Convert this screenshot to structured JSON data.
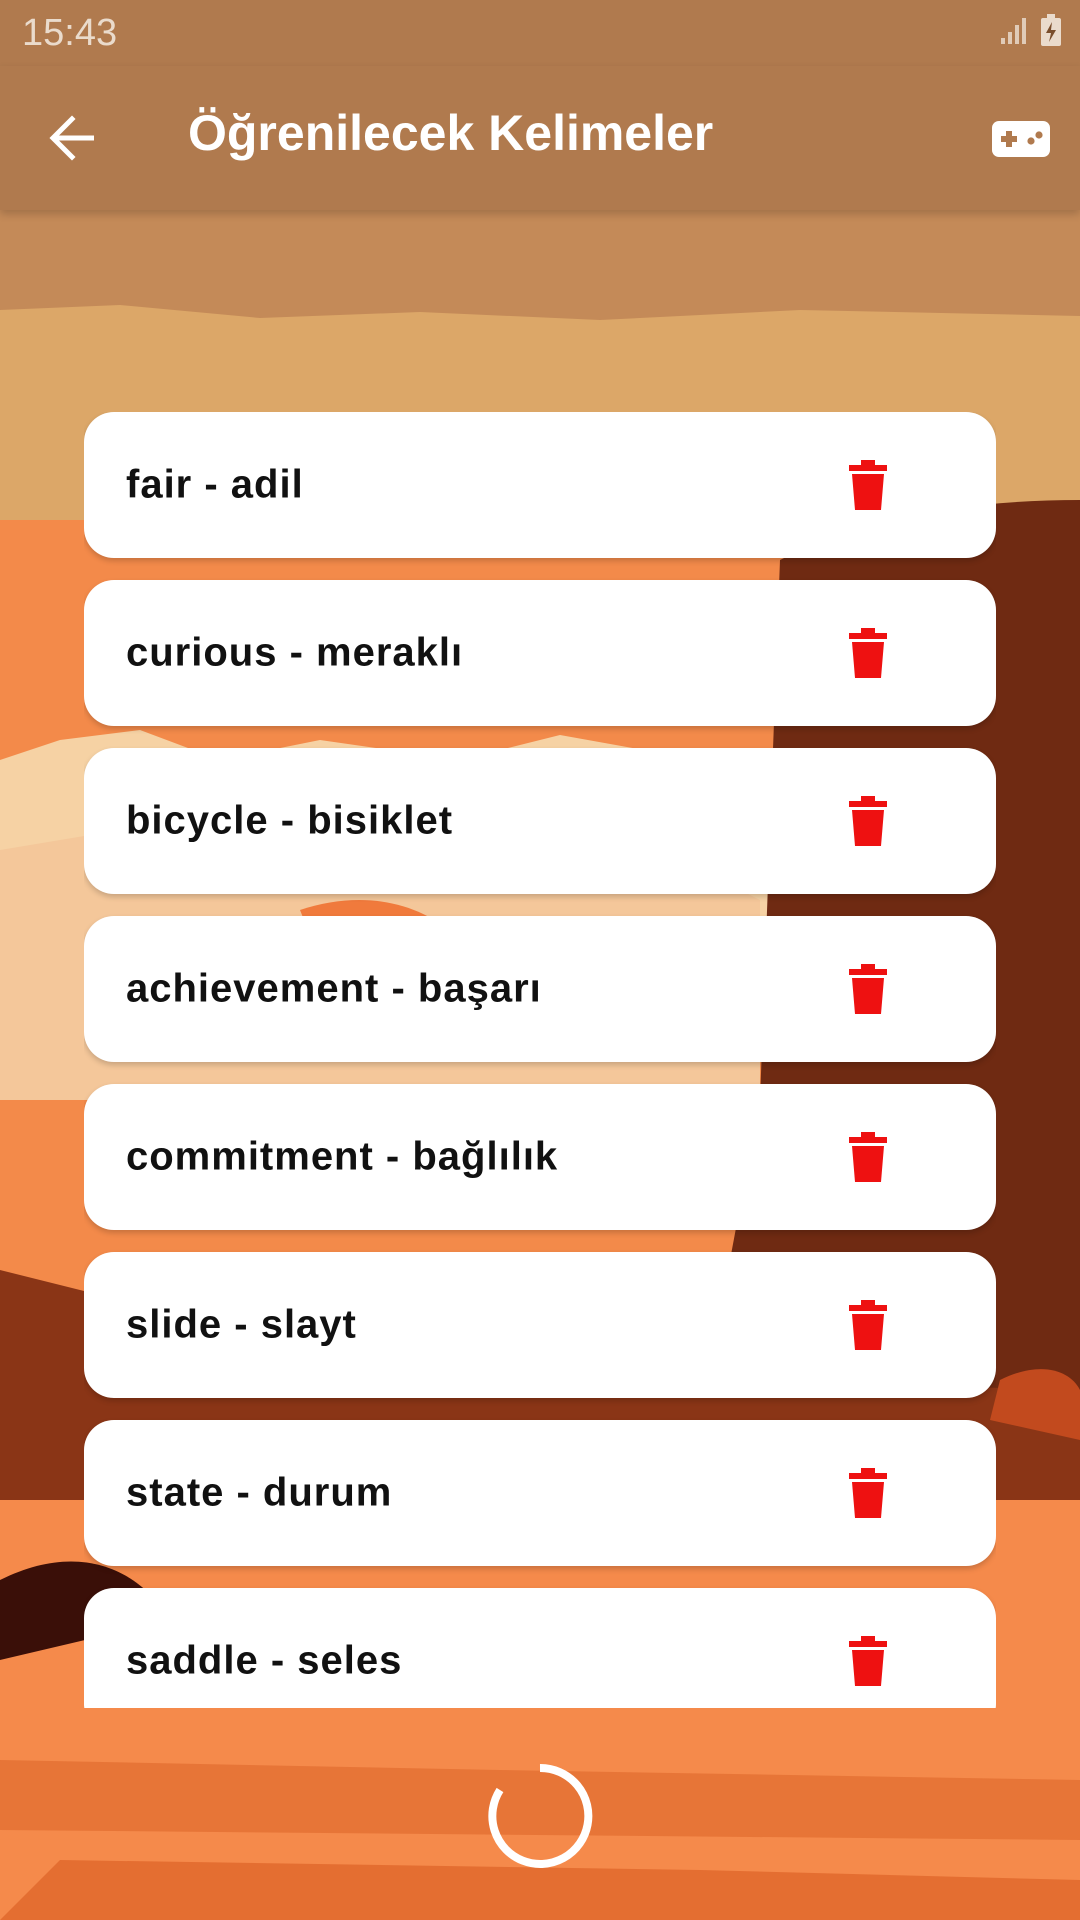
{
  "status": {
    "time": "15:43"
  },
  "appbar": {
    "title": "Öğrenilecek Kelimeler",
    "back_icon": "arrow-back-icon",
    "action_icon": "gamepad-icon"
  },
  "words": [
    {
      "label": "fair - adil"
    },
    {
      "label": "curious - meraklı"
    },
    {
      "label": "bicycle - bisiklet"
    },
    {
      "label": "achievement - başarı"
    },
    {
      "label": "commitment - bağlılık"
    },
    {
      "label": "slide - slayt"
    },
    {
      "label": "state - durum"
    },
    {
      "label": "saddle - seles"
    }
  ],
  "colors": {
    "appbar": "#b07a4e",
    "delete": "#ee1111",
    "card": "#ffffff"
  }
}
